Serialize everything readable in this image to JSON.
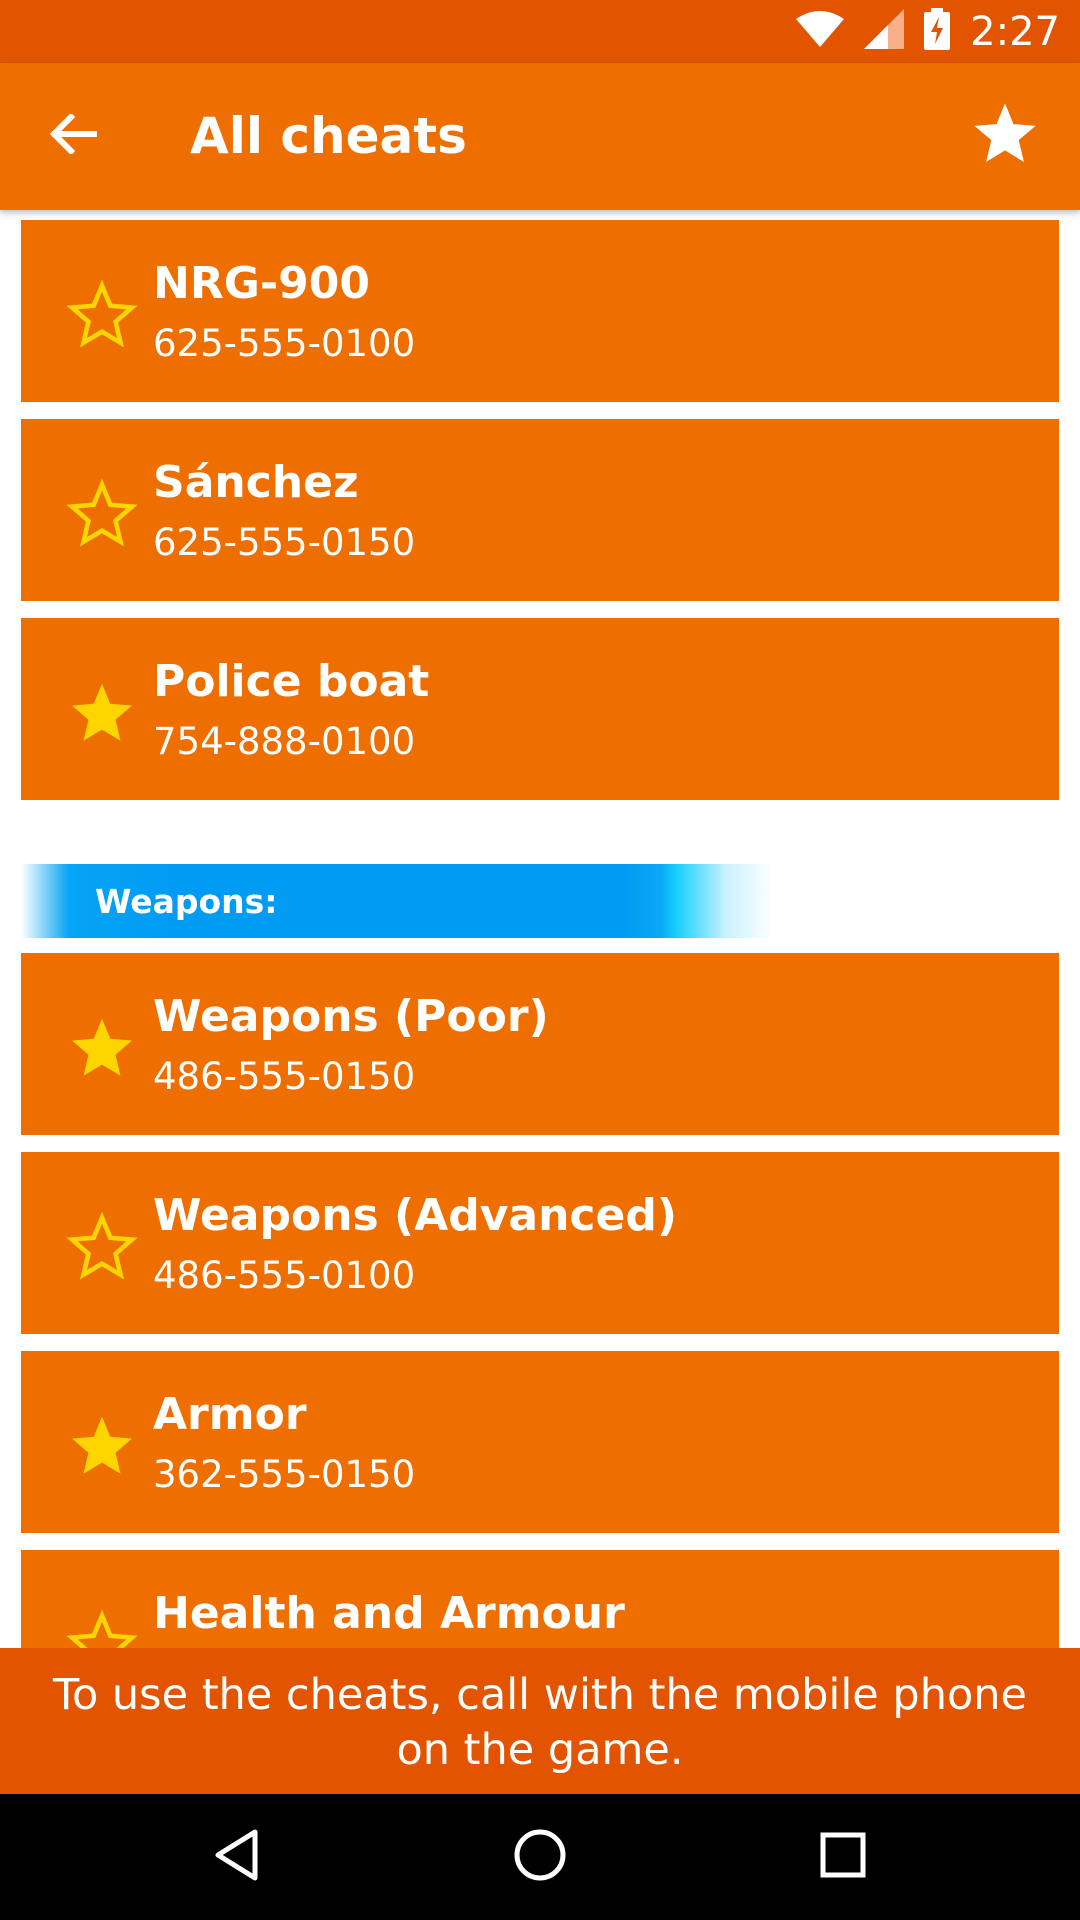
{
  "status_bar": {
    "time": "2:27"
  },
  "app_bar": {
    "title": "All cheats"
  },
  "cheats_top": [
    {
      "name": "NRG-900",
      "code": "625-555-0100",
      "favorite": false
    },
    {
      "name": "Sánchez",
      "code": "625-555-0150",
      "favorite": false
    },
    {
      "name": "Police boat",
      "code": "754-888-0100",
      "favorite": true
    }
  ],
  "section_weapons": {
    "title": "Weapons:"
  },
  "cheats_weapons": [
    {
      "name": "Weapons (Poor)",
      "code": "486-555-0150",
      "favorite": true
    },
    {
      "name": "Weapons (Advanced)",
      "code": "486-555-0100",
      "favorite": false
    },
    {
      "name": "Armor",
      "code": "362-555-0150",
      "favorite": true
    },
    {
      "name": "Health and Armour",
      "code": "",
      "favorite": false
    }
  ],
  "hint": {
    "text": "To use the cheats, call with the mobile phone on the game."
  },
  "colors": {
    "status_bar": "#e35400",
    "app_bar": "#ef6e00",
    "card": "#ef6e00",
    "star": "#ffd500",
    "section": "#009bf3"
  },
  "icons": {
    "back": "arrow-left-icon",
    "favorites": "star-icon",
    "favorite_filled": "star-filled-icon",
    "favorite_outline": "star-outline-icon",
    "nav_back": "triangle-back-icon",
    "nav_home": "circle-home-icon",
    "nav_recents": "square-recents-icon"
  }
}
